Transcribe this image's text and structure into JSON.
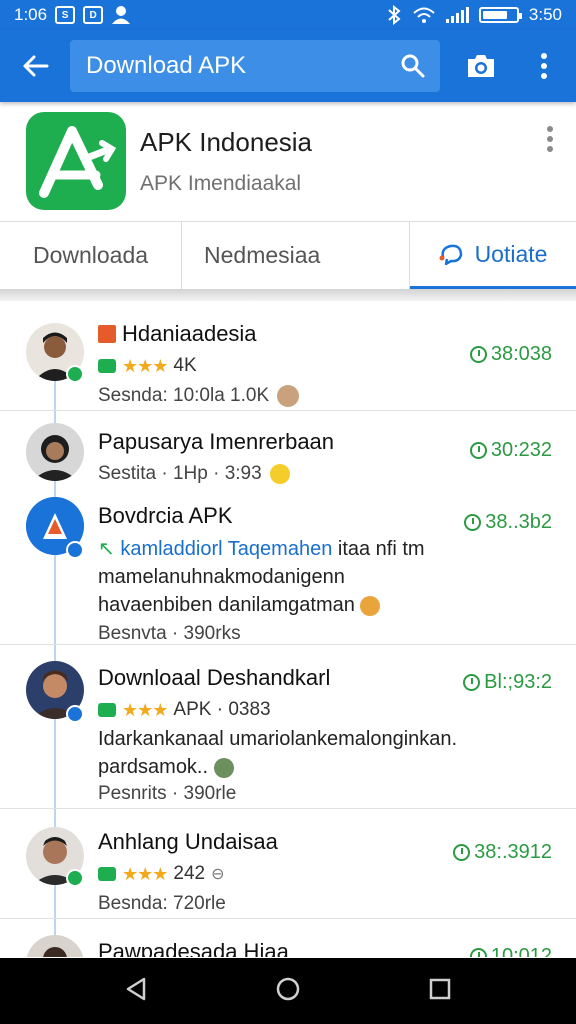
{
  "status_bar": {
    "time": "1:06",
    "clock": "3:50",
    "icon_labels": [
      "S",
      "D"
    ]
  },
  "toolbar": {
    "search_query": "Download APK"
  },
  "app": {
    "name": "APK Indonesia",
    "subtitle": "APK Imendiaakal"
  },
  "tabs": [
    {
      "label": "Downloada"
    },
    {
      "label": "Nedmesiaa"
    },
    {
      "label": "Uotiate"
    }
  ],
  "feed": [
    {
      "title": "Hdaniaadesia",
      "rating_text": "4K",
      "meta": "Sesnda: 10:0la 1.0K",
      "time": "38:038",
      "avatar_color": "#3b2f26"
    },
    {
      "title": "Papusarya Imenrerbaan",
      "meta": "Sestita · 1Hp · 3:93",
      "time": "30:232",
      "avatar_color": "#2d2a2a"
    },
    {
      "title": "Bovdrcia APK",
      "highlight": "kamladdiorl Taqemahen",
      "body_rest": " itaa nfi tm mamelanuhnakmodanigenn havaenbiben danilamgatman",
      "meta": "Besnvta · 390rks",
      "time": "38..3b2",
      "avatar_color": "#1a73d9"
    },
    {
      "title": "Downloaal Deshandkarl",
      "rating_text": "APK · 0383",
      "body": "Idarkankanaal umariolankemalonginkan. pardsamok..",
      "meta": "Pesnrits · 390rle",
      "time": "Bl:;93:2",
      "avatar_color": "#4a3327"
    },
    {
      "title": "Anhlang Undaisaa",
      "rating_text": "242",
      "meta": "Besnda: 720rle",
      "time": "38:.3912",
      "avatar_color": "#3a2b22"
    },
    {
      "title": "Pawpadesada Hiaa",
      "time": "10:012",
      "avatar_color": "#2b2222"
    }
  ],
  "colors": {
    "primary": "#1a73d9",
    "app_icon": "#1fae4f",
    "time_green": "#2c9a43",
    "star": "#f2a91c"
  }
}
